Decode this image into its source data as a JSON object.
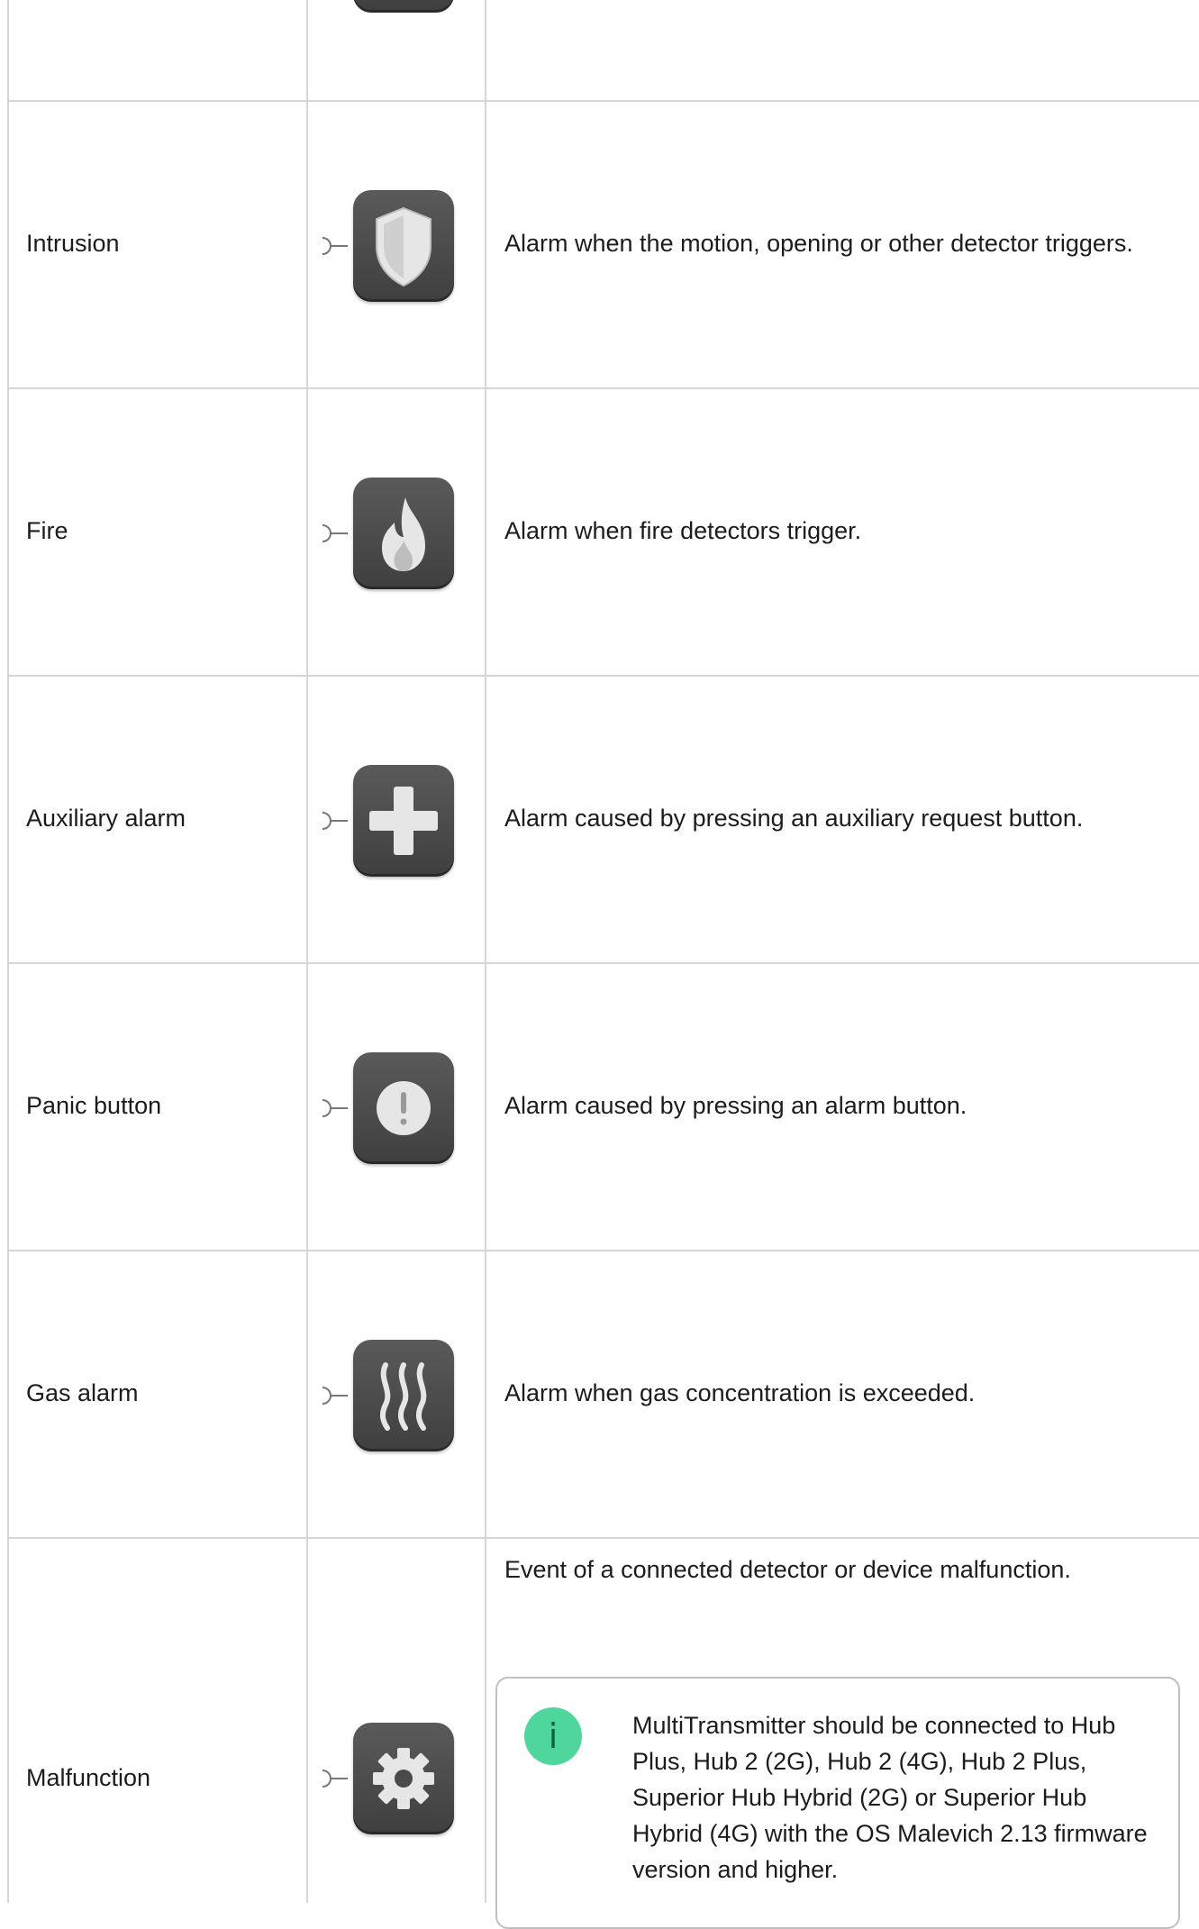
{
  "rows": [
    {
      "name": "Intrusion",
      "icon": "shield-icon",
      "description": "Alarm when the motion, opening or other detector triggers."
    },
    {
      "name": "Fire",
      "icon": "flame-icon",
      "description": "Alarm when fire detectors trigger."
    },
    {
      "name": "Auxiliary alarm",
      "icon": "plus-icon",
      "description": "Alarm caused by pressing an auxiliary request button."
    },
    {
      "name": "Panic button",
      "icon": "exclamation-icon",
      "description": "Alarm caused by pressing an alarm button."
    },
    {
      "name": "Gas alarm",
      "icon": "gas-waves-icon",
      "description": "Alarm when gas concentration is exceeded."
    },
    {
      "name": "Malfunction",
      "icon": "gear-icon",
      "description": "Event of a connected detector or device malfunction."
    }
  ],
  "note": {
    "icon": "info-icon",
    "badge": "i",
    "text": "MultiTransmitter should be connected to Hub Plus, Hub 2 (2G), Hub 2 (4G), Hub 2 Plus, Superior Hub Hybrid (2G) or Superior Hub Hybrid (4G) with the OS Malevich 2.13 firmware version and higher."
  },
  "colors": {
    "tile": "#4a4a4a",
    "icon_fill": "#e8e8e8",
    "border": "#d6d6d6",
    "info_badge": "#4fd69c"
  }
}
